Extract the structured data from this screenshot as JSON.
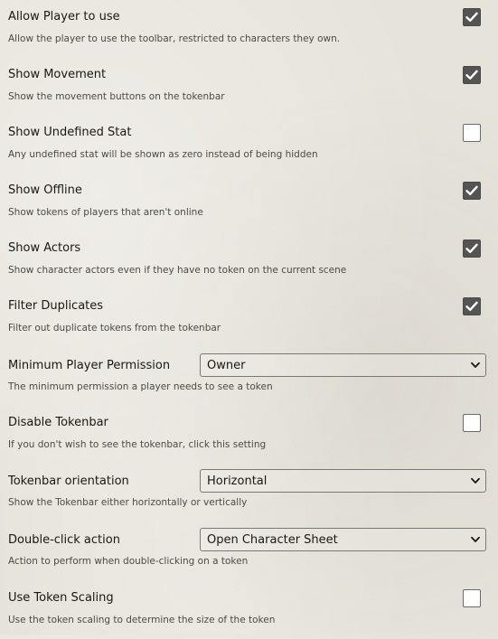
{
  "settings": [
    {
      "label": "Allow Player to use",
      "hint": "Allow the player to use the toolbar, restricted to characters they own.",
      "type": "checkbox",
      "checked": true
    },
    {
      "label": "Show Movement",
      "hint": "Show the movement buttons on the tokenbar",
      "type": "checkbox",
      "checked": true
    },
    {
      "label": "Show Undefined Stat",
      "hint": "Any undefined stat will be shown as zero instead of being hidden",
      "type": "checkbox",
      "checked": false
    },
    {
      "label": "Show Offline",
      "hint": "Show tokens of players that aren't online",
      "type": "checkbox",
      "checked": true
    },
    {
      "label": "Show Actors",
      "hint": "Show character actors even if they have no token on the current scene",
      "type": "checkbox",
      "checked": true
    },
    {
      "label": "Filter Duplicates",
      "hint": "Filter out duplicate tokens from the tokenbar",
      "type": "checkbox",
      "checked": true
    },
    {
      "label": "Minimum Player Permission",
      "hint": "The minimum permission a player needs to see a token",
      "type": "select",
      "value": "Owner"
    },
    {
      "label": "Disable Tokenbar",
      "hint": "If you don't wish to see the tokenbar, click this setting",
      "type": "checkbox",
      "checked": false
    },
    {
      "label": "Tokenbar orientation",
      "hint": "Show the Tokenbar either horizontally or vertically",
      "type": "select",
      "value": "Horizontal"
    },
    {
      "label": "Double-click action",
      "hint": "Action to perform when double-clicking on a token",
      "type": "select",
      "value": "Open Character Sheet"
    },
    {
      "label": "Use Token Scaling",
      "hint": "Use the token scaling to determine the size of the token",
      "type": "checkbox",
      "checked": false
    }
  ],
  "icons": {
    "checkmark": "checkmark-icon",
    "dropdown": "chevron-down-icon"
  },
  "colors": {
    "checked_fill": "#545454",
    "text": "#191813",
    "hint": "#4b4a44"
  }
}
